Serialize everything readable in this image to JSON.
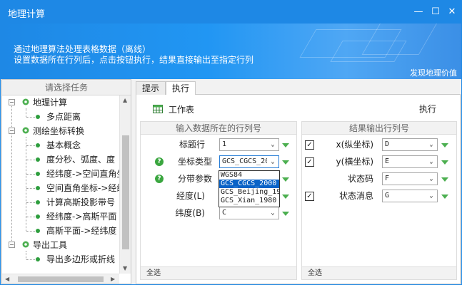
{
  "window": {
    "title": "地理计算",
    "minimize": "—",
    "maximize": "☐",
    "close": "✕"
  },
  "banner": {
    "line1": "通过地理算法处理表格数据（离线）",
    "line2": "设置数据所在行列后，点击按钮执行，结果直接输出至指定行列",
    "brand": "发现地理价值"
  },
  "left_panel": {
    "title": "请选择任务",
    "tree": [
      {
        "label": "地理计算",
        "level": 0,
        "type": "group"
      },
      {
        "label": "多点距离",
        "level": 1,
        "type": "leaf"
      },
      {
        "label": "测绘坐标转换",
        "level": 0,
        "type": "group"
      },
      {
        "label": "基本概念",
        "level": 1,
        "type": "leaf"
      },
      {
        "label": "度分秒、弧度、度",
        "level": 1,
        "type": "leaf"
      },
      {
        "label": "经纬度->空间直角坐",
        "level": 1,
        "type": "leaf"
      },
      {
        "label": "空间直角坐标->经纬",
        "level": 1,
        "type": "leaf"
      },
      {
        "label": "计算高斯投影带号",
        "level": 1,
        "type": "leaf"
      },
      {
        "label": "经纬度->高斯平面",
        "level": 1,
        "type": "leaf"
      },
      {
        "label": "高斯平面->经纬度",
        "level": 1,
        "type": "leaf"
      },
      {
        "label": "导出工具",
        "level": 0,
        "type": "group"
      },
      {
        "label": "导出多边形或折线",
        "level": 1,
        "type": "leaf"
      }
    ]
  },
  "tabs": [
    {
      "label": "提示",
      "active": false
    },
    {
      "label": "执行",
      "active": true
    }
  ],
  "main": {
    "worksheet_label": "工作表",
    "execute_label": "执行",
    "input_header": "输入数据所在的行列号",
    "output_header": "结果输出行列号",
    "select_all_left": "全选",
    "select_all_right": "全选",
    "inputs": [
      {
        "label": "标题行",
        "value": "1",
        "help": false
      },
      {
        "label": "坐标类型",
        "value": "GCS_CGCS_20",
        "help": true
      },
      {
        "label": "分带参数",
        "value": "",
        "help": true
      },
      {
        "label": "经度(L)",
        "value": "",
        "help": false
      },
      {
        "label": "纬度(B)",
        "value": "C",
        "help": false
      }
    ],
    "outputs": [
      {
        "label": "x(纵坐标)",
        "value": "D",
        "checked": true
      },
      {
        "label": "y(横坐标)",
        "value": "E",
        "checked": true
      },
      {
        "label": "状态码",
        "value": "F",
        "checked": false
      },
      {
        "label": "状态消息",
        "value": "G",
        "checked": true
      }
    ],
    "help_glyph": "?",
    "check_glyph": "✓",
    "dropdown_glyph": "⌄"
  },
  "coord_dropdown": {
    "options": [
      "WGS84",
      "GCS_CGCS_2000",
      "GCS_Beijing_19",
      "GCS_Xian_1980"
    ],
    "selected_index": 1
  },
  "colors": {
    "title_bar": "#1e88e5",
    "accent_green": "#4caf50",
    "selection": "#0a63c7"
  }
}
